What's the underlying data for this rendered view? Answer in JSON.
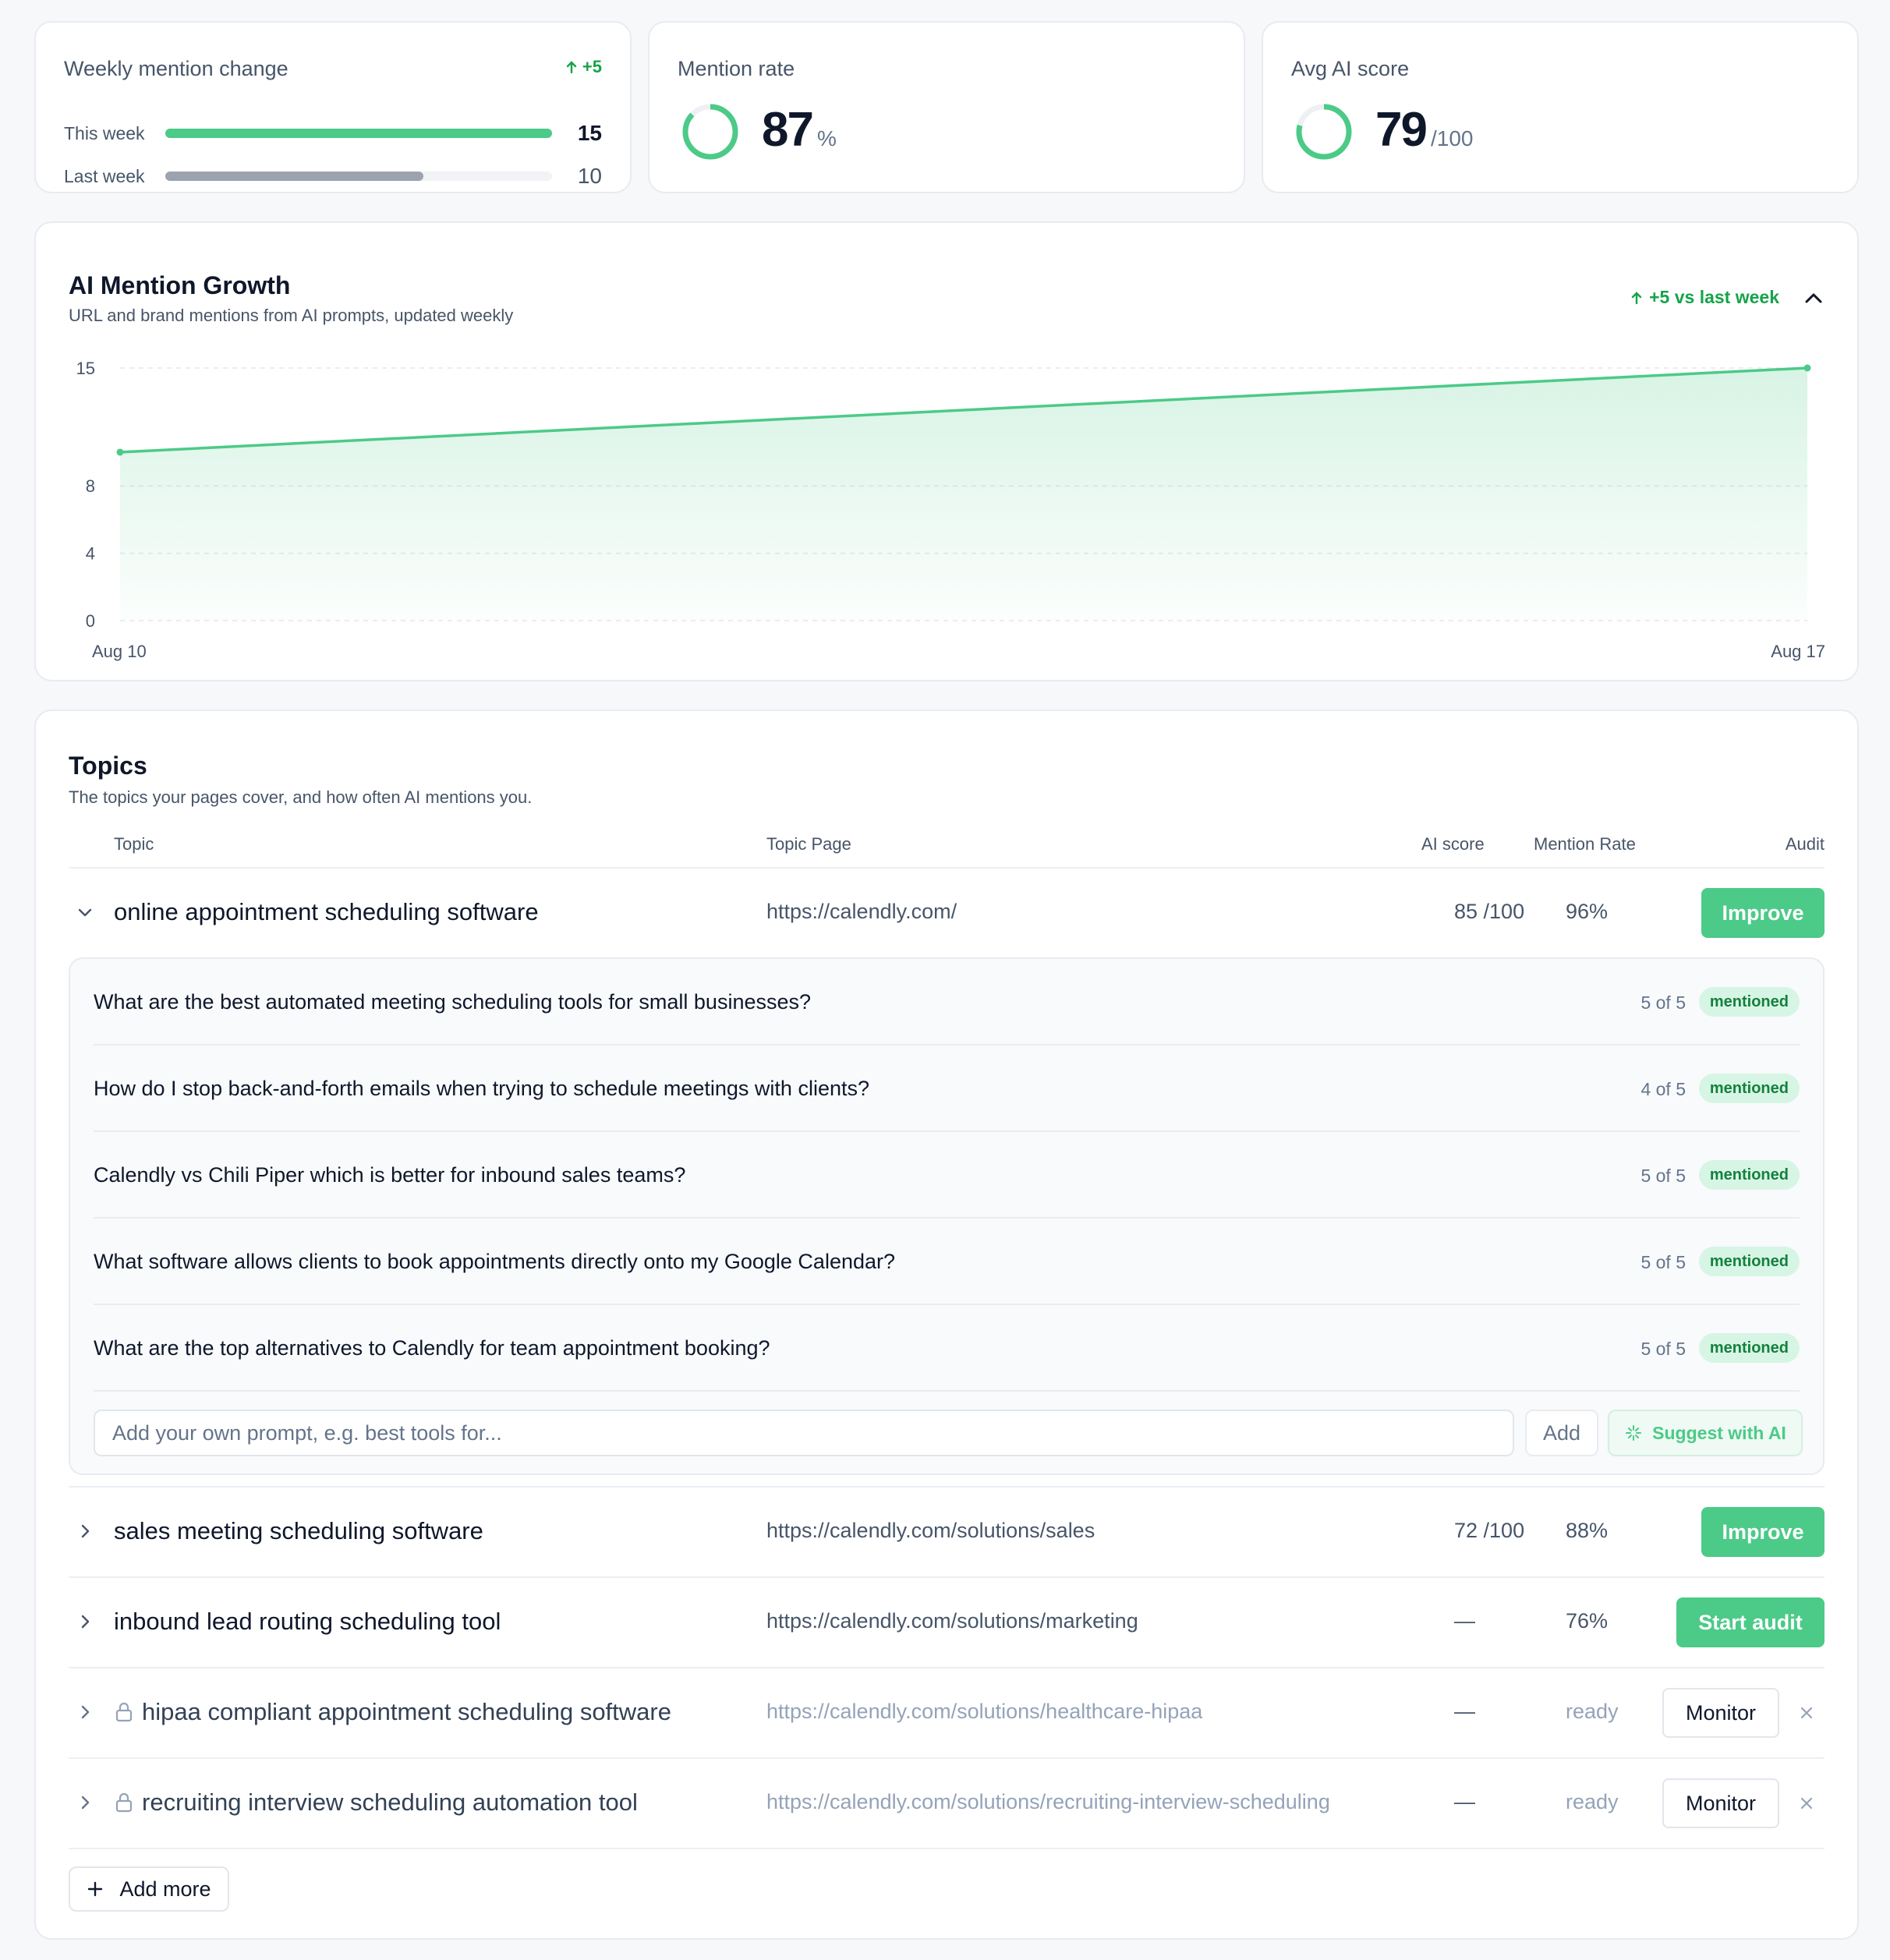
{
  "weekly": {
    "title": "Weekly mention change",
    "delta": "+5",
    "this_week_label": "This week",
    "this_week_value": "15",
    "last_week_label": "Last week",
    "last_week_value": "10",
    "this_week_fraction": 1.0,
    "last_week_fraction": 0.667
  },
  "mention_rate": {
    "title": "Mention rate",
    "value": "87",
    "unit": "%",
    "fraction": 0.87
  },
  "avg_score": {
    "title": "Avg AI score",
    "value": "79",
    "unit": "/100",
    "fraction": 0.79
  },
  "growth": {
    "title": "AI Mention Growth",
    "subtitle": "URL and brand mentions from AI prompts, updated weekly",
    "delta": "+5 vs last week"
  },
  "chart_data": {
    "type": "area",
    "x": [
      "Aug 10",
      "Aug 17"
    ],
    "values": [
      10,
      15
    ],
    "yticks": [
      15,
      8,
      4,
      0
    ],
    "ylim": [
      0,
      15
    ],
    "grid": true,
    "color": "#4cca88"
  },
  "topics": {
    "title": "Topics",
    "subtitle": "The topics your pages cover, and how often AI mentions you.",
    "columns": {
      "topic": "Topic",
      "page": "Topic Page",
      "score": "AI score",
      "rate": "Mention Rate",
      "audit": "Audit"
    },
    "rows": [
      {
        "topic": "online appointment scheduling software",
        "page": "https://calendly.com/",
        "score": "85 /100",
        "rate": "96%",
        "action": "Improve"
      },
      {
        "topic": "sales meeting scheduling software",
        "page": "https://calendly.com/solutions/sales",
        "score": "72 /100",
        "rate": "88%",
        "action": "Improve"
      },
      {
        "topic": "inbound lead routing scheduling tool",
        "page": "https://calendly.com/solutions/marketing",
        "score": "—",
        "rate": "76%",
        "action": "Start audit"
      },
      {
        "topic": "hipaa compliant appointment scheduling software",
        "page": "https://calendly.com/solutions/healthcare-hipaa",
        "score": "—",
        "rate": "ready",
        "action": "Monitor"
      },
      {
        "topic": "recruiting interview scheduling automation tool",
        "page": "https://calendly.com/solutions/recruiting-interview-scheduling",
        "score": "—",
        "rate": "ready",
        "action": "Monitor"
      }
    ],
    "prompts": [
      {
        "q": "What are the best automated meeting scheduling tools for small businesses?",
        "count": "5 of 5",
        "badge": "mentioned"
      },
      {
        "q": "How do I stop back-and-forth emails when trying to schedule meetings with clients?",
        "count": "4 of 5",
        "badge": "mentioned"
      },
      {
        "q": "Calendly vs Chili Piper which is better for inbound sales teams?",
        "count": "5 of 5",
        "badge": "mentioned"
      },
      {
        "q": "What software allows clients to book appointments directly onto my Google Calendar?",
        "count": "5 of 5",
        "badge": "mentioned"
      },
      {
        "q": "What are the top alternatives to Calendly for team appointment booking?",
        "count": "5 of 5",
        "badge": "mentioned"
      }
    ],
    "prompt_placeholder": "Add your own prompt, e.g. best tools for...",
    "add_label": "Add",
    "suggest_label": "Suggest with AI",
    "add_more_label": "Add more"
  },
  "colors": {
    "accent": "#4cca88",
    "positive": "#16a34a",
    "muted_bar": "#9ca3af"
  }
}
